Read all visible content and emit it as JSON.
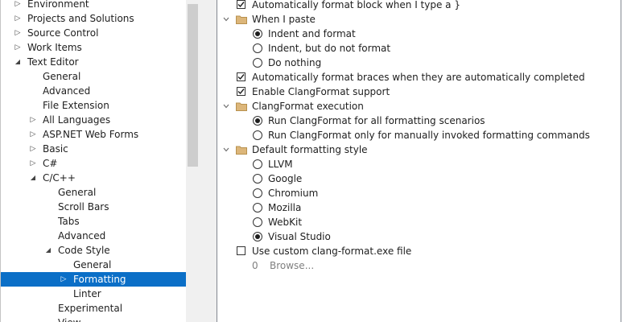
{
  "tree": {
    "items": [
      {
        "label": "Environment",
        "expander": "collapsed"
      },
      {
        "label": "Projects and Solutions",
        "expander": "collapsed"
      },
      {
        "label": "Source Control",
        "expander": "collapsed"
      },
      {
        "label": "Work Items",
        "expander": "collapsed"
      },
      {
        "label": "Text Editor",
        "expander": "expanded"
      },
      {
        "label": "General",
        "expander": "none"
      },
      {
        "label": "Advanced",
        "expander": "none"
      },
      {
        "label": "File Extension",
        "expander": "none"
      },
      {
        "label": "All Languages",
        "expander": "collapsed"
      },
      {
        "label": "ASP.NET Web Forms",
        "expander": "collapsed"
      },
      {
        "label": "Basic",
        "expander": "collapsed"
      },
      {
        "label": "C#",
        "expander": "collapsed"
      },
      {
        "label": "C/C++",
        "expander": "expanded"
      },
      {
        "label": "General",
        "expander": "none"
      },
      {
        "label": "Scroll Bars",
        "expander": "none"
      },
      {
        "label": "Tabs",
        "expander": "none"
      },
      {
        "label": "Advanced",
        "expander": "none"
      },
      {
        "label": "Code Style",
        "expander": "expanded"
      },
      {
        "label": "General",
        "expander": "none"
      },
      {
        "label": "Formatting",
        "expander": "collapsed",
        "selected": true
      },
      {
        "label": "Linter",
        "expander": "none"
      },
      {
        "label": "Experimental",
        "expander": "none"
      },
      {
        "label": "View",
        "expander": "none"
      }
    ]
  },
  "settings": {
    "auto_format_block": {
      "label": "Automatically format block when I type a }",
      "checked": true
    },
    "when_i_paste": {
      "label": "When I paste",
      "options": [
        {
          "label": "Indent and format",
          "selected": true
        },
        {
          "label": "Indent, but do not format",
          "selected": false
        },
        {
          "label": "Do nothing",
          "selected": false
        }
      ]
    },
    "auto_format_braces": {
      "label": "Automatically format braces when they are automatically completed",
      "checked": true
    },
    "enable_clangformat": {
      "label": "Enable ClangFormat support",
      "checked": true
    },
    "clangformat_execution": {
      "label": "ClangFormat execution",
      "options": [
        {
          "label": "Run ClangFormat for all formatting scenarios",
          "selected": true
        },
        {
          "label": "Run ClangFormat only for manually invoked formatting commands",
          "selected": false
        }
      ]
    },
    "default_style": {
      "label": "Default formatting style",
      "options": [
        {
          "label": "LLVM",
          "selected": false
        },
        {
          "label": "Google",
          "selected": false
        },
        {
          "label": "Chromium",
          "selected": false
        },
        {
          "label": "Mozilla",
          "selected": false
        },
        {
          "label": "WebKit",
          "selected": false
        },
        {
          "label": "Visual Studio",
          "selected": true
        }
      ]
    },
    "custom_clang_file": {
      "label": "Use custom clang-format.exe file",
      "checked": false
    },
    "browse": {
      "value": "0",
      "label": "Browse..."
    }
  },
  "icons": {
    "expander_collapsed": "triangle-right-icon",
    "expander_expanded": "triangle-down-right-icon",
    "group": "folder-icon",
    "group_chevron": "chevron-down-icon"
  },
  "colors": {
    "selection": "#0b6fc7",
    "folder": "#dcb67a"
  }
}
